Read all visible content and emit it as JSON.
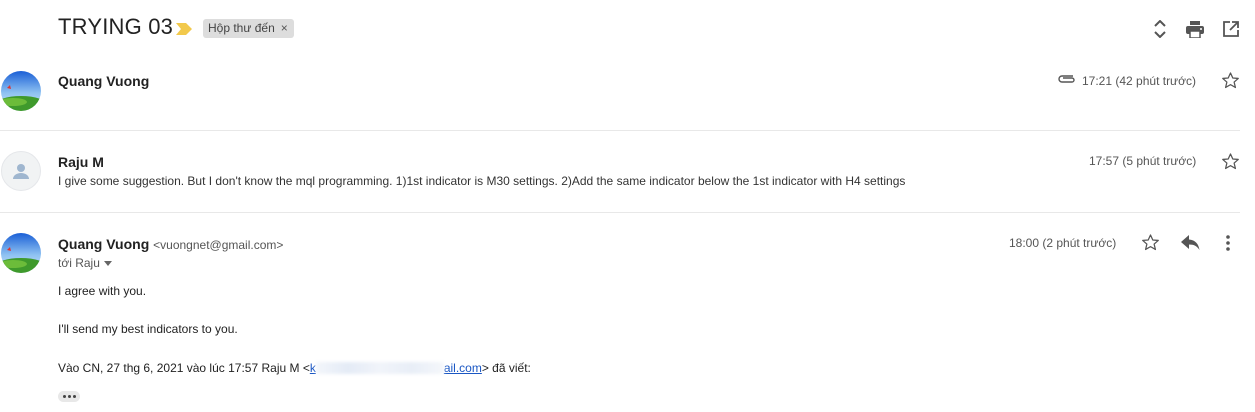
{
  "thread": {
    "subject": "TRYING 03",
    "label": "Hộp thư đến",
    "label_remove": "×"
  },
  "icons": {
    "expand": "unfold-icon",
    "print": "printer-icon",
    "popout": "open-in-new-window-icon",
    "importance": "importance-marker-icon",
    "attachment": "paperclip-icon",
    "star": "star-outline-icon",
    "reply": "reply-icon",
    "more": "more-vertical-icon"
  },
  "messages": [
    {
      "sender": "Quang Vuong",
      "time": "17:21 (42 phút trước)",
      "has_attachment": true,
      "collapsed": true
    },
    {
      "sender": "Raju M",
      "time": "17:57 (5 phút trước)",
      "snippet": "I give some suggestion. But I don't know the mql programming. 1)1st indicator is M30 settings. 2)Add the same indicator below the 1st indicator with H4 settings",
      "collapsed": true
    },
    {
      "sender": "Quang Vuong",
      "email": "<vuongnet@gmail.com>",
      "to": "tới Raju",
      "time": "18:00 (2 phút trước)",
      "body_lines": [
        "I agree with you.",
        "I'll send my best indicators to you."
      ],
      "quote_prefix": "Vào CN, 27 thg 6, 2021 vào lúc 17:57 Raju M <",
      "quote_link_start": "k",
      "quote_link_end": "ail.com",
      "quote_suffix": "> đã viết:"
    }
  ],
  "colors": {
    "link": "#1a57c4",
    "importance": "#f2c94c",
    "label_bg": "#dddddd"
  }
}
